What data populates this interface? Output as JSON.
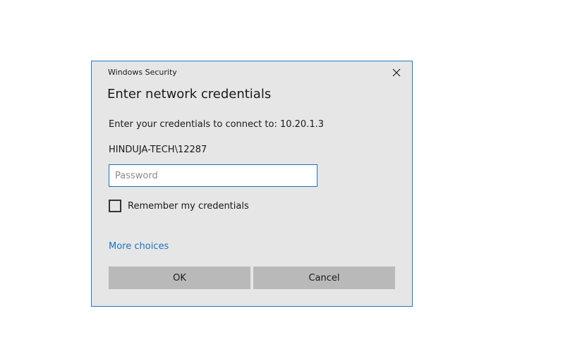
{
  "window": {
    "title": "Windows Security"
  },
  "dialog": {
    "heading": "Enter network credentials",
    "prompt": "Enter your credentials to connect to: 10.20.1.3",
    "username": "HINDUJA-TECH\\12287",
    "password": {
      "value": "",
      "placeholder": "Password"
    },
    "remember": {
      "label": "Remember my credentials",
      "checked": false
    },
    "more_choices_label": "More choices",
    "ok_label": "OK",
    "cancel_label": "Cancel"
  },
  "icons": {
    "close": "close-icon"
  },
  "colors": {
    "accent": "#1e7bc8",
    "link": "#1e74c2",
    "dialog_bg": "#e6e6e6",
    "button_bg": "#b9b9b9"
  }
}
